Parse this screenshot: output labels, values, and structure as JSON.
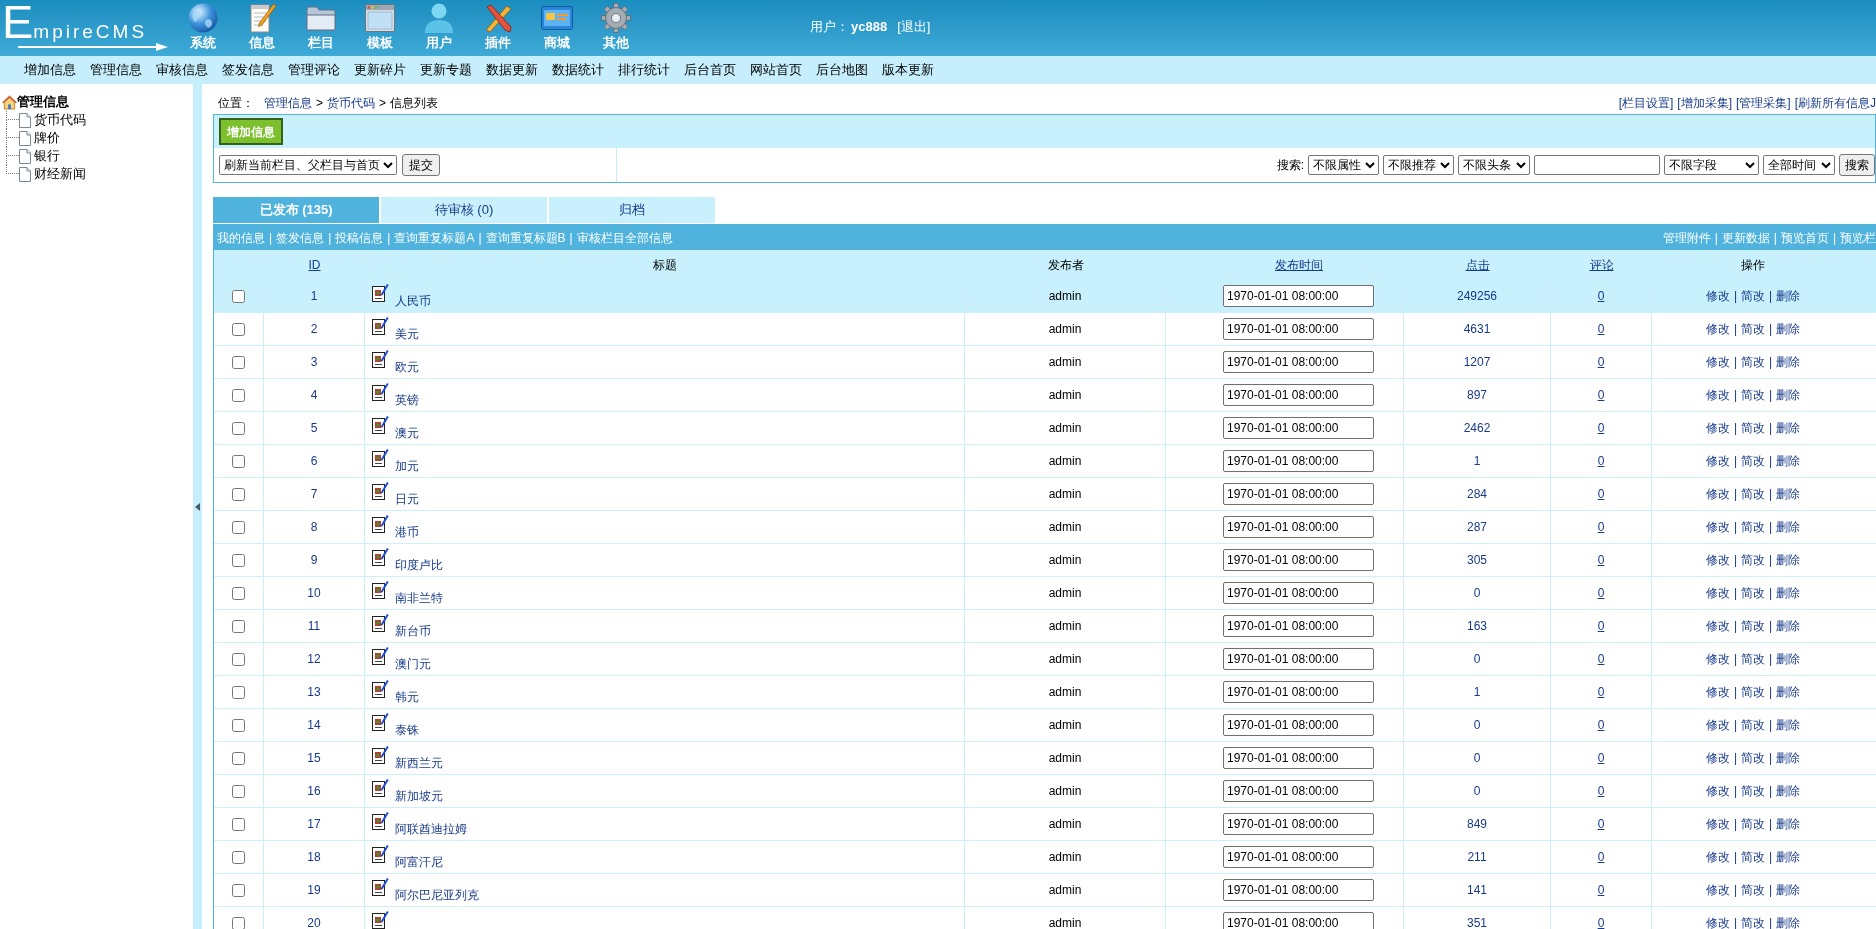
{
  "header": {
    "logo": "EmpireCMS",
    "menu": [
      {
        "label": "系统"
      },
      {
        "label": "信息"
      },
      {
        "label": "栏目"
      },
      {
        "label": "模板"
      },
      {
        "label": "用户"
      },
      {
        "label": "插件"
      },
      {
        "label": "商城"
      },
      {
        "label": "其他"
      }
    ],
    "user": {
      "label": "用户：",
      "name": "yc888",
      "logout": "[退出]"
    }
  },
  "nav": [
    "增加信息",
    "管理信息",
    "审核信息",
    "签发信息",
    "管理评论",
    "更新碎片",
    "更新专题",
    "数据更新",
    "数据统计",
    "排行统计",
    "后台首页",
    "网站首页",
    "后台地图",
    "版本更新"
  ],
  "sidebar": {
    "tree": [
      {
        "label": "管理信息",
        "children": [
          {
            "label": "货币代码"
          },
          {
            "label": "牌价"
          },
          {
            "label": "银行"
          },
          {
            "label": "财经新闻"
          }
        ]
      }
    ]
  },
  "breadcrumb": {
    "label": "位置：",
    "parts": [
      {
        "kind": "link",
        "text": "管理信息"
      },
      {
        "kind": "sep",
        "text": ">"
      },
      {
        "kind": "link",
        "text": "货币代码"
      },
      {
        "kind": "sep",
        "text": ">"
      },
      {
        "kind": "text",
        "text": "信息列表"
      }
    ]
  },
  "top_links": [
    "[栏目设置]",
    "[增加采集]",
    "[管理采集]",
    "[刷新所有信息J"
  ],
  "toolbar": {
    "add_button": "增加信息",
    "refresh_select": "刷新当前栏目、父栏目与首页",
    "submit_button": "提交",
    "search": {
      "label": "搜索:",
      "controls": [
        {
          "kind": "select",
          "value": "不限属性"
        },
        {
          "kind": "select",
          "value": "不限推荐"
        },
        {
          "kind": "select",
          "value": "不限头条"
        },
        {
          "kind": "input"
        },
        {
          "kind": "select",
          "value": "不限字段"
        },
        {
          "kind": "select",
          "value": "全部时间"
        }
      ],
      "button": "搜索"
    }
  },
  "tabs": [
    {
      "label": "已发布 (135)",
      "selected": true
    },
    {
      "label": "待审核 (0)",
      "selected": false
    },
    {
      "label": "归档",
      "selected": false
    }
  ],
  "list_bar": {
    "left": [
      "我的信息",
      "|",
      "签发信息",
      "|",
      "投稿信息",
      "|",
      "查询重复标题A",
      "|",
      "查询重复标题B",
      "|",
      "审核栏目全部信息"
    ],
    "right": [
      "管理附件",
      "|",
      "更新数据",
      "|",
      "预览首页",
      "|",
      "预览栏"
    ]
  },
  "table": {
    "columns": [
      {
        "label": "ID",
        "sortable": true
      },
      {
        "label": "标题",
        "sortable": false
      },
      {
        "label": "发布者",
        "sortable": false
      },
      {
        "label": "发布时间",
        "sortable": true
      },
      {
        "label": "点击",
        "sortable": true
      },
      {
        "label": "评论",
        "sortable": true
      },
      {
        "label": "操作",
        "sortable": false
      }
    ],
    "rows": [
      {
        "checked": false,
        "highlighted": true,
        "id": "1",
        "title": "人民币",
        "author": "admin",
        "time": "1970-01-01 08:00:00",
        "hits": "249256",
        "comments": "0",
        "actions": [
          "修改",
          "|",
          "简改",
          "|",
          "删除"
        ]
      },
      {
        "checked": false,
        "highlighted": false,
        "id": "2",
        "title": "美元",
        "author": "admin",
        "time": "1970-01-01 08:00:00",
        "hits": "4631",
        "comments": "0",
        "actions": [
          "修改",
          "|",
          "简改",
          "|",
          "删除"
        ]
      },
      {
        "checked": false,
        "highlighted": false,
        "id": "3",
        "title": "欧元",
        "author": "admin",
        "time": "1970-01-01 08:00:00",
        "hits": "1207",
        "comments": "0",
        "actions": [
          "修改",
          "|",
          "简改",
          "|",
          "删除"
        ]
      },
      {
        "checked": false,
        "highlighted": false,
        "id": "4",
        "title": "英镑",
        "author": "admin",
        "time": "1970-01-01 08:00:00",
        "hits": "897",
        "comments": "0",
        "actions": [
          "修改",
          "|",
          "简改",
          "|",
          "删除"
        ]
      },
      {
        "checked": false,
        "highlighted": false,
        "id": "5",
        "title": "澳元",
        "author": "admin",
        "time": "1970-01-01 08:00:00",
        "hits": "2462",
        "comments": "0",
        "actions": [
          "修改",
          "|",
          "简改",
          "|",
          "删除"
        ]
      },
      {
        "checked": false,
        "highlighted": false,
        "id": "6",
        "title": "加元",
        "author": "admin",
        "time": "1970-01-01 08:00:00",
        "hits": "1",
        "comments": "0",
        "actions": [
          "修改",
          "|",
          "简改",
          "|",
          "删除"
        ]
      },
      {
        "checked": false,
        "highlighted": false,
        "id": "7",
        "title": "日元",
        "author": "admin",
        "time": "1970-01-01 08:00:00",
        "hits": "284",
        "comments": "0",
        "actions": [
          "修改",
          "|",
          "简改",
          "|",
          "删除"
        ]
      },
      {
        "checked": false,
        "highlighted": false,
        "id": "8",
        "title": "港币",
        "author": "admin",
        "time": "1970-01-01 08:00:00",
        "hits": "287",
        "comments": "0",
        "actions": [
          "修改",
          "|",
          "简改",
          "|",
          "删除"
        ]
      },
      {
        "checked": false,
        "highlighted": false,
        "id": "9",
        "title": "印度卢比",
        "author": "admin",
        "time": "1970-01-01 08:00:00",
        "hits": "305",
        "comments": "0",
        "actions": [
          "修改",
          "|",
          "简改",
          "|",
          "删除"
        ]
      },
      {
        "checked": false,
        "highlighted": false,
        "id": "10",
        "title": "南非兰特",
        "author": "admin",
        "time": "1970-01-01 08:00:00",
        "hits": "0",
        "comments": "0",
        "actions": [
          "修改",
          "|",
          "简改",
          "|",
          "删除"
        ]
      },
      {
        "checked": false,
        "highlighted": false,
        "id": "11",
        "title": "新台币",
        "author": "admin",
        "time": "1970-01-01 08:00:00",
        "hits": "163",
        "comments": "0",
        "actions": [
          "修改",
          "|",
          "简改",
          "|",
          "删除"
        ]
      },
      {
        "checked": false,
        "highlighted": false,
        "id": "12",
        "title": "澳门元",
        "author": "admin",
        "time": "1970-01-01 08:00:00",
        "hits": "0",
        "comments": "0",
        "actions": [
          "修改",
          "|",
          "简改",
          "|",
          "删除"
        ]
      },
      {
        "checked": false,
        "highlighted": false,
        "id": "13",
        "title": "韩元",
        "author": "admin",
        "time": "1970-01-01 08:00:00",
        "hits": "1",
        "comments": "0",
        "actions": [
          "修改",
          "|",
          "简改",
          "|",
          "删除"
        ]
      },
      {
        "checked": false,
        "highlighted": false,
        "id": "14",
        "title": "泰铢",
        "author": "admin",
        "time": "1970-01-01 08:00:00",
        "hits": "0",
        "comments": "0",
        "actions": [
          "修改",
          "|",
          "简改",
          "|",
          "删除"
        ]
      },
      {
        "checked": false,
        "highlighted": false,
        "id": "15",
        "title": "新西兰元",
        "author": "admin",
        "time": "1970-01-01 08:00:00",
        "hits": "0",
        "comments": "0",
        "actions": [
          "修改",
          "|",
          "简改",
          "|",
          "删除"
        ]
      },
      {
        "checked": false,
        "highlighted": false,
        "id": "16",
        "title": "新加坡元",
        "author": "admin",
        "time": "1970-01-01 08:00:00",
        "hits": "0",
        "comments": "0",
        "actions": [
          "修改",
          "|",
          "简改",
          "|",
          "删除"
        ]
      },
      {
        "checked": false,
        "highlighted": false,
        "id": "17",
        "title": "阿联酋迪拉姆",
        "author": "admin",
        "time": "1970-01-01 08:00:00",
        "hits": "849",
        "comments": "0",
        "actions": [
          "修改",
          "|",
          "简改",
          "|",
          "删除"
        ]
      },
      {
        "checked": false,
        "highlighted": false,
        "id": "18",
        "title": "阿富汗尼",
        "author": "admin",
        "time": "1970-01-01 08:00:00",
        "hits": "211",
        "comments": "0",
        "actions": [
          "修改",
          "|",
          "简改",
          "|",
          "删除"
        ]
      },
      {
        "checked": false,
        "highlighted": false,
        "id": "19",
        "title": "阿尔巴尼亚列克",
        "author": "admin",
        "time": "1970-01-01 08:00:00",
        "hits": "141",
        "comments": "0",
        "actions": [
          "修改",
          "|",
          "简改",
          "|",
          "删除"
        ]
      },
      {
        "checked": false,
        "highlighted": false,
        "id": "20",
        "author": "admin",
        "time": "1970-01-01 08:00:00",
        "hits": "351",
        "comments": "0",
        "actions": [
          "修改",
          "|",
          "简改",
          "|",
          "删除"
        ]
      }
    ]
  }
}
